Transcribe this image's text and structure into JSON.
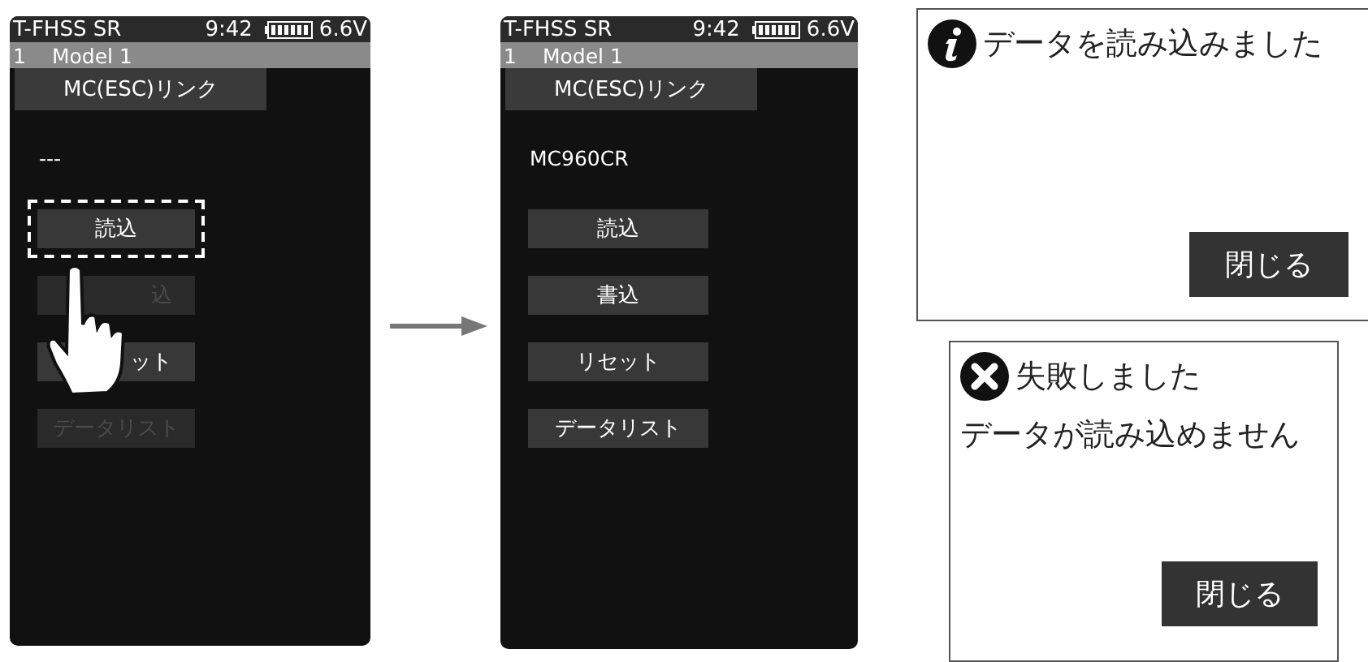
{
  "screens": [
    {
      "status": {
        "system": "T-FHSS SR",
        "time": "9:42",
        "voltage": "6.6V"
      },
      "model": {
        "number": "1",
        "name": "Model 1"
      },
      "title": "MC(ESC)リンク",
      "device": "---",
      "touch": true,
      "buttons": [
        {
          "label": "読込",
          "disabled": false,
          "focused": true,
          "covered": false
        },
        {
          "label": "込",
          "disabled": true,
          "focused": false,
          "covered": true
        },
        {
          "label": "ット",
          "disabled": false,
          "focused": false,
          "covered": true
        },
        {
          "label": "データリスト",
          "disabled": true,
          "focused": false,
          "covered": false
        }
      ]
    },
    {
      "status": {
        "system": "T-FHSS SR",
        "time": "9:42",
        "voltage": "6.6V"
      },
      "model": {
        "number": "1",
        "name": "Model 1"
      },
      "title": "MC(ESC)リンク",
      "device": "MC960CR",
      "touch": false,
      "buttons": [
        {
          "label": "読込",
          "disabled": false,
          "focused": false,
          "covered": false
        },
        {
          "label": "書込",
          "disabled": false,
          "focused": false,
          "covered": false
        },
        {
          "label": "リセット",
          "disabled": false,
          "focused": false,
          "covered": false
        },
        {
          "label": "データリスト",
          "disabled": false,
          "focused": false,
          "covered": false
        }
      ]
    }
  ],
  "dialogs": [
    {
      "kind": "info",
      "title": "データを読み込みました",
      "button": "閉じる"
    },
    {
      "kind": "error",
      "title": "失敗しました",
      "message": "データが読み込めません",
      "button": "閉じる"
    }
  ]
}
